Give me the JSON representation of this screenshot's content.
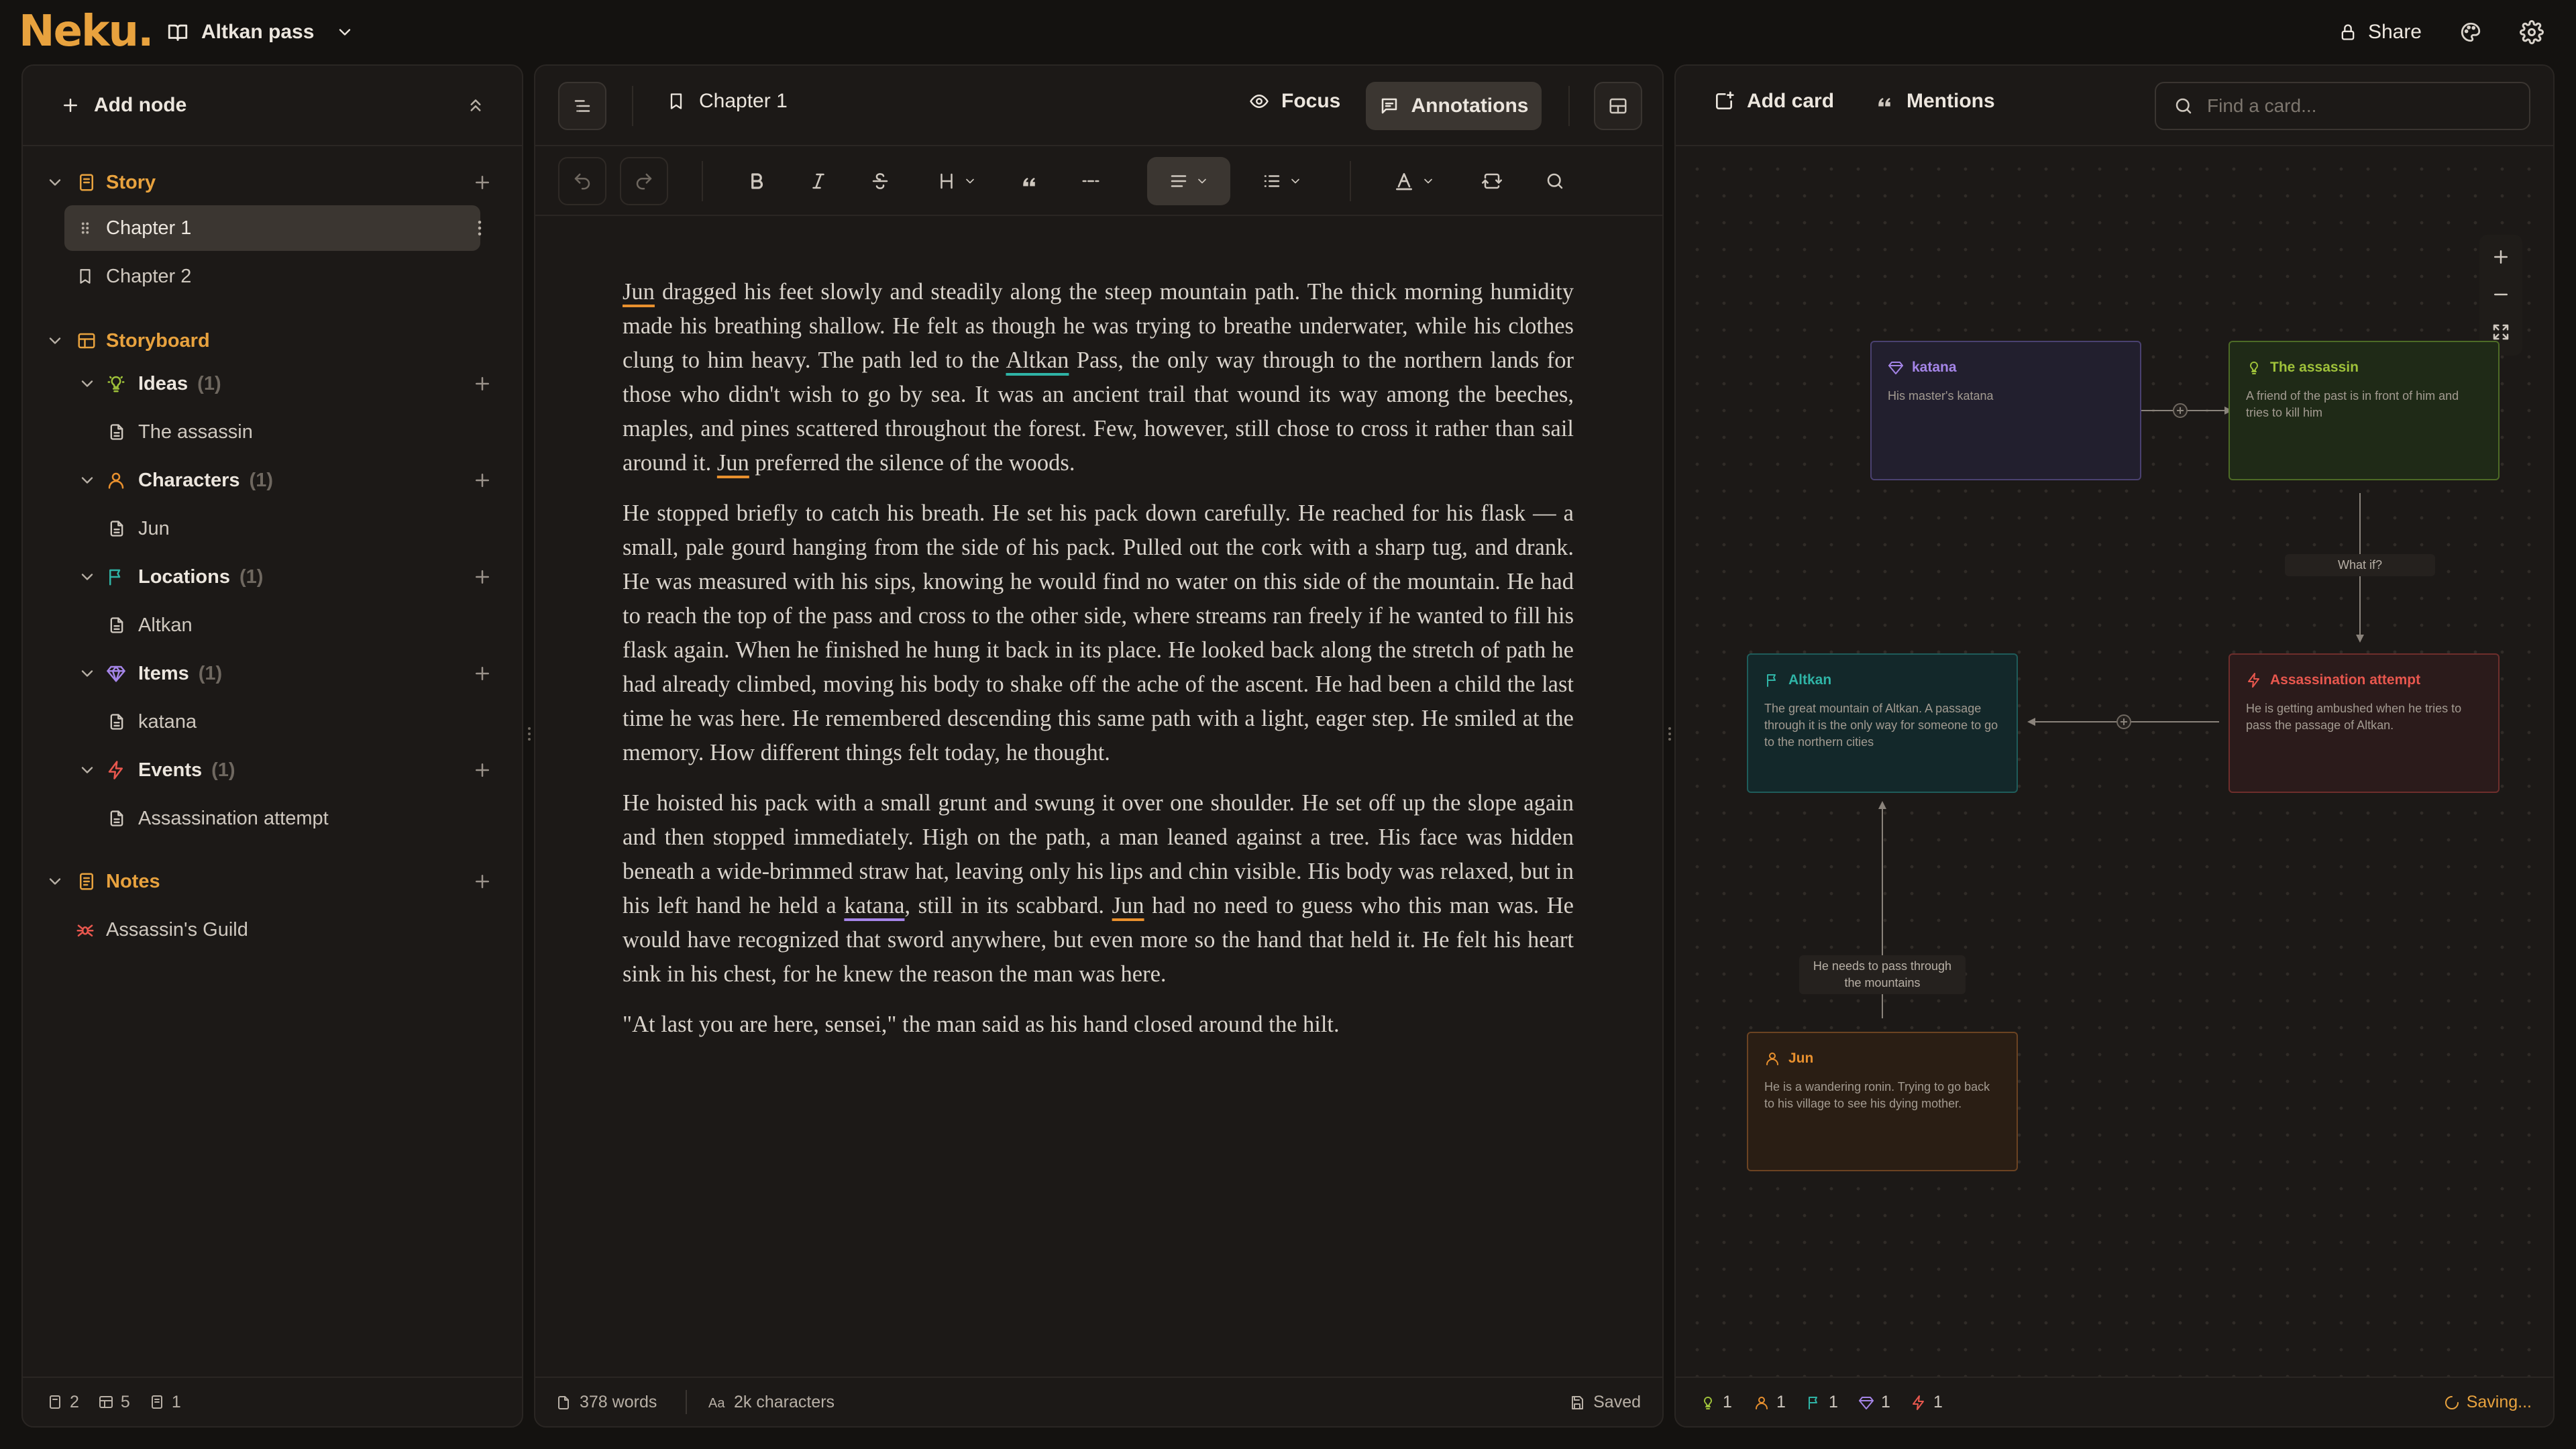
{
  "app": {
    "logo": "Neku.",
    "project": "Altkan pass"
  },
  "topbar": {
    "share_label": "Share"
  },
  "sidebar": {
    "add_node_label": "Add node",
    "sections": {
      "story": {
        "label": "Story",
        "items": [
          "Chapter 1",
          "Chapter 2"
        ]
      },
      "storyboard": {
        "label": "Storyboard",
        "groups": [
          {
            "label": "Ideas",
            "count": "(1)",
            "item": "The assassin"
          },
          {
            "label": "Characters",
            "count": "(1)",
            "item": "Jun"
          },
          {
            "label": "Locations",
            "count": "(1)",
            "item": "Altkan"
          },
          {
            "label": "Items",
            "count": "(1)",
            "item": "katana"
          },
          {
            "label": "Events",
            "count": "(1)",
            "item": "Assassination attempt"
          }
        ]
      },
      "notes": {
        "label": "Notes",
        "items": [
          "Assassin's Guild"
        ]
      }
    },
    "footer": {
      "chapters": "2",
      "storyboard": "5",
      "notes": "1"
    }
  },
  "editor": {
    "chapter_title": "Chapter 1",
    "focus_label": "Focus",
    "annotations_label": "Annotations",
    "paragraphs": [
      [
        {
          "t": "Jun",
          "mark": "character"
        },
        {
          "t": " dragged his feet slowly and steadily along the steep mountain path. The thick morning humidity made his breathing shallow. He felt as though he was trying to breathe underwater, while his clothes clung to him heavy. The path led to the "
        },
        {
          "t": "Altkan",
          "mark": "location"
        },
        {
          "t": " Pass, the only way through to the northern lands for those who didn't wish to go by sea. It was an ancient trail that wound its way among the beeches, maples, and pines scattered throughout the forest. Few, however, still chose to cross it rather than sail around it. "
        },
        {
          "t": "Jun",
          "mark": "character"
        },
        {
          "t": " preferred the silence of the woods."
        }
      ],
      [
        {
          "t": "He stopped briefly to catch his breath. He set his pack down carefully. He reached for his flask — a small, pale gourd hanging from the side of his pack. Pulled out the cork with a sharp tug, and drank. He was measured with his sips, knowing he would find no water on this side of the mountain. He had to reach the top of the pass and cross to the other side, where streams ran freely if he wanted to fill his flask again. When he finished he hung it back in its place. He looked back along the stretch of path he had already climbed, moving his body to shake off the ache of the ascent. He had been a child the last time he was here. He remembered descending this same path with a light, eager step. He smiled at the memory. How different things felt today, he thought."
        }
      ],
      [
        {
          "t": "He hoisted his pack with a small grunt and swung it over one shoulder. He set off up the slope again and then stopped immediately. High on the path, a man leaned against a tree. His face was hidden beneath a wide-brimmed straw hat, leaving only his lips and chin visible. His body was relaxed, but in his left hand he held a "
        },
        {
          "t": "katana",
          "mark": "item"
        },
        {
          "t": ", still in its scabbard. "
        },
        {
          "t": "Jun",
          "mark": "character"
        },
        {
          "t": " had no need to guess who this man was. He would have recognized that sword anywhere, but even more so the hand that held it. He felt his heart sink in his chest, for he knew the reason the man was here."
        }
      ],
      [
        {
          "t": "\"At last you are here, sensei,\" the man said as his hand closed around the hilt."
        }
      ]
    ],
    "footer": {
      "words": "378 words",
      "characters": "2k characters",
      "status": "Saved"
    }
  },
  "board": {
    "add_card_label": "Add card",
    "mentions_label": "Mentions",
    "search_placeholder": "Find a card...",
    "cards": {
      "katana": {
        "title": "katana",
        "desc": "His master's katana"
      },
      "assassin": {
        "title": "The assassin",
        "desc": "A friend of the past is in front of him and tries to kill him"
      },
      "altkan": {
        "title": "Altkan",
        "desc": "The great mountain of Altkan. A passage through it is the only way for someone to go to the northern cities"
      },
      "attempt": {
        "title": "Assassination attempt",
        "desc": "He is getting ambushed when he tries to pass the passage of Altkan."
      },
      "jun": {
        "title": "Jun",
        "desc": "He is a wandering ronin. Trying to go back to his village to see his dying mother."
      }
    },
    "edge_labels": {
      "whatif": "What if?",
      "needs": "He needs to pass through the mountains"
    },
    "footer": {
      "ideas": "1",
      "characters": "1",
      "locations": "1",
      "items": "1",
      "events": "1",
      "status": "Saving..."
    }
  },
  "colors": {
    "accent": "#e8a23e",
    "idea": "#9fc23a",
    "character": "#e8902e",
    "location": "#2fb4a6",
    "item": "#a585e8",
    "event": "#e8574e"
  }
}
